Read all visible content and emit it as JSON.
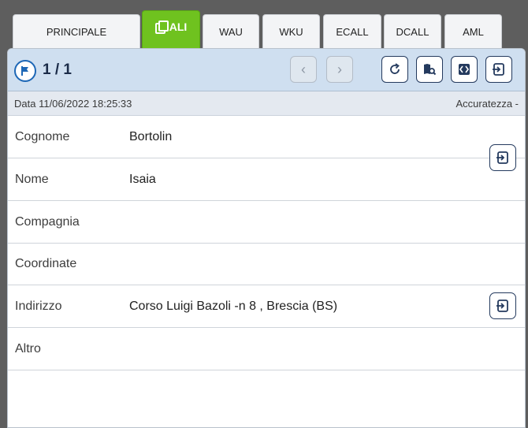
{
  "tabs": [
    {
      "label": "PRINCIPALE",
      "active": false
    },
    {
      "label": "ALI",
      "active": true
    },
    {
      "label": "WAU",
      "active": false
    },
    {
      "label": "WKU",
      "active": false
    },
    {
      "label": "ECALL",
      "active": false
    },
    {
      "label": "DCALL",
      "active": false
    },
    {
      "label": "AML",
      "active": false
    }
  ],
  "toolbar": {
    "counter": "1 / 1",
    "buttons": [
      "flag-icon",
      "prev-icon",
      "next-icon",
      "refresh-icon",
      "map-search-icon",
      "map-icon",
      "export-icon"
    ]
  },
  "info": {
    "date": "Data 11/06/2022 18:25:33",
    "accuracy": "Accuratezza -"
  },
  "fields": [
    {
      "label": "Cognome",
      "value": "Bortolin"
    },
    {
      "label": "Nome",
      "value": "Isaia"
    },
    {
      "label": "Compagnia",
      "value": ""
    },
    {
      "label": "Coordinate",
      "value": ""
    },
    {
      "label": "Indirizzo",
      "value": "Corso Luigi Bazoli -n 8 , Brescia (BS)"
    },
    {
      "label": "Altro",
      "value": ""
    }
  ],
  "colors": {
    "active_tab": "#6fc21f",
    "toolbar_bg": "#cfdff0",
    "icon_dark": "#243a5e",
    "accent_blue": "#1d67b6"
  }
}
